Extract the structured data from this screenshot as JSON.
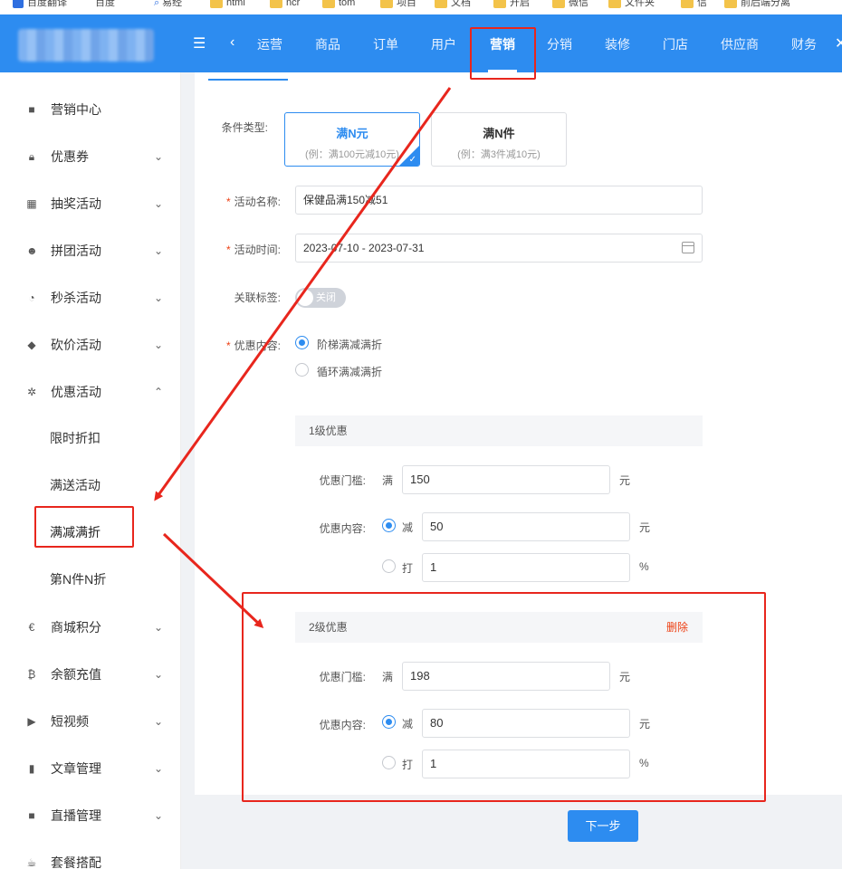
{
  "bookmarks": [
    {
      "label": "百度翻译",
      "icon": "translate-icon"
    },
    {
      "label": "百度",
      "icon": "bookmark-icon"
    },
    {
      "label": "易经",
      "icon": "search-bookmark-icon"
    },
    {
      "label": "html",
      "icon": "folder-icon"
    },
    {
      "label": "ncr",
      "icon": "folder-icon"
    },
    {
      "label": "tom",
      "icon": "folder-icon"
    },
    {
      "label": "项目",
      "icon": "folder-icon"
    },
    {
      "label": "文档",
      "icon": "folder-icon"
    },
    {
      "label": "开启",
      "icon": "folder-icon"
    },
    {
      "label": "微信",
      "icon": "folder-icon"
    },
    {
      "label": "文件夹",
      "icon": "folder-icon"
    },
    {
      "label": "信",
      "icon": "folder-icon"
    },
    {
      "label": "前后端分离",
      "icon": "folder-icon"
    }
  ],
  "topnav": {
    "items": [
      "运营",
      "商品",
      "订单",
      "用户",
      "营销",
      "分销",
      "装修",
      "门店",
      "供应商",
      "财务"
    ],
    "active": "营销"
  },
  "sidebar": {
    "items": [
      {
        "label": "营销中心",
        "icon": "marketing-center-icon",
        "chevron": ""
      },
      {
        "label": "优惠券",
        "icon": "lock-icon",
        "chevron": "⌄"
      },
      {
        "label": "抽奖活动",
        "icon": "grid-icon",
        "chevron": "⌄"
      },
      {
        "label": "拼团活动",
        "icon": "users-icon",
        "chevron": "⌄"
      },
      {
        "label": "秒杀活动",
        "icon": "clock-icon",
        "chevron": "⌄"
      },
      {
        "label": "砍价活动",
        "icon": "tag-icon",
        "chevron": "⌄"
      },
      {
        "label": "优惠活动",
        "icon": "gift-icon",
        "chevron": "⌃"
      }
    ],
    "sub_items": [
      "限时折扣",
      "满送活动",
      "满减满折",
      "第N件N折"
    ],
    "active_sub": "满减满折",
    "bottom_items": [
      {
        "label": "商城积分",
        "icon": "euro-icon",
        "chevron": "⌄"
      },
      {
        "label": "余额充值",
        "icon": "bitcoin-icon",
        "chevron": "⌄"
      },
      {
        "label": "短视频",
        "icon": "video-icon",
        "chevron": "⌄"
      },
      {
        "label": "文章管理",
        "icon": "article-icon",
        "chevron": "⌄"
      },
      {
        "label": "直播管理",
        "icon": "camera-icon",
        "chevron": "⌄"
      },
      {
        "label": "套餐搭配",
        "icon": "cup-icon",
        "chevron": ""
      }
    ]
  },
  "form": {
    "condition_type_label": "条件类型:",
    "types": [
      {
        "title": "满N元",
        "sub": "(例：满100元减10元)",
        "selected": true
      },
      {
        "title": "满N件",
        "sub": "(例：满3件减10元)",
        "selected": false
      }
    ],
    "name_label": "活动名称:",
    "name_value": "保健品满150减51",
    "time_label": "活动时间:",
    "time_value": "2023-07-10 - 2023-07-31",
    "tag_label": "关联标签:",
    "tag_switch": "关闭",
    "content_label": "优惠内容:",
    "content_options": [
      "阶梯满减满折",
      "循环满减满折"
    ],
    "content_selected": "阶梯满减满折"
  },
  "levels": [
    {
      "title": "1级优惠",
      "delete_label": "",
      "threshold_label": "优惠门槛:",
      "threshold_prefix": "满",
      "threshold_value": "150",
      "threshold_unit": "元",
      "content_label": "优惠内容:",
      "reduce_label": "减",
      "reduce_value": "50",
      "reduce_unit": "元",
      "discount_label": "打",
      "discount_value": "1",
      "discount_unit": "%"
    },
    {
      "title": "2级优惠",
      "delete_label": "删除",
      "threshold_label": "优惠门槛:",
      "threshold_prefix": "满",
      "threshold_value": "198",
      "threshold_unit": "元",
      "content_label": "优惠内容:",
      "reduce_label": "减",
      "reduce_value": "80",
      "reduce_unit": "元",
      "discount_label": "打",
      "discount_value": "1",
      "discount_unit": "%"
    }
  ],
  "next_button": "下一步",
  "colors": {
    "primary": "#2d8cf0",
    "annotation": "#e8261d",
    "required": "#ed4014"
  }
}
